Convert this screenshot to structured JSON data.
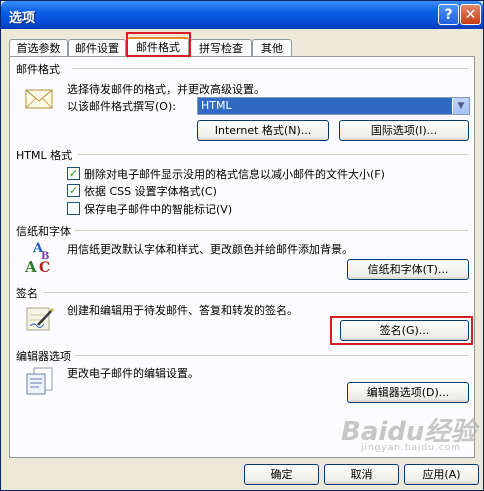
{
  "window": {
    "title": "选项"
  },
  "titlebar": {
    "help_label": "?",
    "close_label": "✕"
  },
  "tabs": [
    {
      "label": "首选参数"
    },
    {
      "label": "邮件设置"
    },
    {
      "label": "邮件格式"
    },
    {
      "label": "拼写检查"
    },
    {
      "label": "其他"
    }
  ],
  "mail_format": {
    "title": "邮件格式",
    "description": "选择待发邮件的格式，并更改高级设置。",
    "compose_label": "以该邮件格式撰写(O):",
    "compose_value": "HTML",
    "internet_button": "Internet 格式(N)...",
    "intl_button": "国际选项(I)..."
  },
  "html_format": {
    "title": "HTML 格式",
    "options": [
      {
        "label": "删除对电子邮件显示没用的格式信息以减小邮件的文件大小(F)",
        "checked": true
      },
      {
        "label": "依据 CSS 设置字体格式(C)",
        "checked": true
      },
      {
        "label": "保存电子邮件中的智能标记(V)",
        "checked": false
      }
    ]
  },
  "stationery": {
    "title": "信纸和字体",
    "description": "用信纸更改默认字体和样式、更改颜色并给邮件添加背景。",
    "button": "信纸和字体(T)..."
  },
  "signature": {
    "title": "签名",
    "description": "创建和编辑用于待发邮件、答复和转发的签名。",
    "button": "签名(G)..."
  },
  "editor": {
    "title": "编辑器选项",
    "description": "更改电子邮件的编辑设置。",
    "button": "编辑器选项(D)..."
  },
  "footer": {
    "ok": "确定",
    "cancel": "取消",
    "apply": "应用(A)"
  },
  "watermark": {
    "text": "Baidu经验",
    "sub": "jingyan.baidu.com"
  },
  "colors": {
    "title_bar": "#0a5ee6",
    "dialog_bg": "#ece9d8",
    "highlight": "#d42020",
    "select_bg": "#316ac5"
  }
}
